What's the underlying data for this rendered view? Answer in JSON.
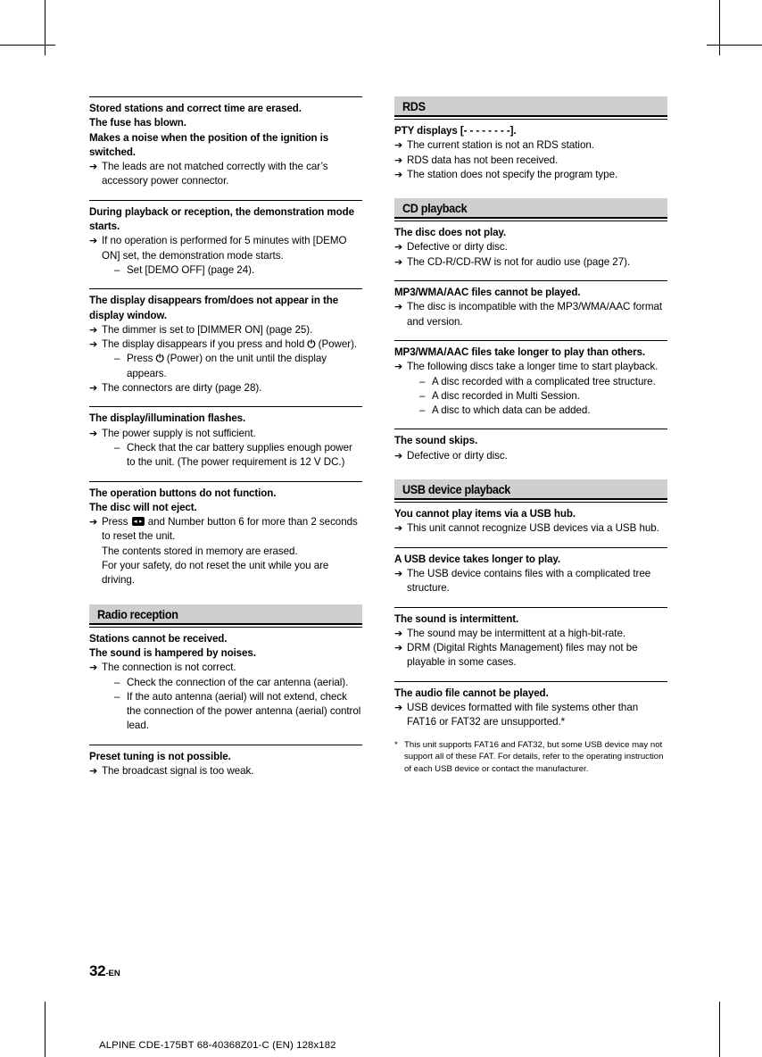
{
  "document": {
    "page_number": "32",
    "page_number_suffix": "-EN",
    "footer": "ALPINE CDE-175BT 68-40368Z01-C (EN) 128x182"
  },
  "left_column": {
    "blocks": [
      {
        "symptoms": [
          "Stored stations and correct time are erased.",
          "The fuse has blown.",
          "Makes a noise when the position of the ignition is switched."
        ],
        "causes": [
          {
            "text": "The leads are not matched correctly with the car’s accessory power connector.",
            "remedies": []
          }
        ]
      },
      {
        "symptoms": [
          "During playback or reception, the demonstration mode starts."
        ],
        "causes": [
          {
            "text": "If no operation is performed for 5 minutes with [DEMO ON] set, the demonstration mode starts.",
            "remedies": [
              "Set [DEMO OFF] (page 24)."
            ]
          }
        ]
      },
      {
        "symptoms": [
          "The display disappears from/does not appear in the display window."
        ],
        "causes": [
          {
            "text": "The dimmer is set to [DIMMER ON] (page 25).",
            "remedies": []
          },
          {
            "text_pre": "The display disappears if you press and hold ",
            "text_post": " (Power).",
            "glyph": "power-icon",
            "remedies_rich": [
              {
                "text_pre": "Press ",
                "text_post": " (Power) on the unit until the display appears.",
                "glyph": "power-icon"
              }
            ]
          },
          {
            "text": "The connectors are dirty (page 28).",
            "remedies": []
          }
        ]
      },
      {
        "symptoms": [
          "The display/illumination flashes."
        ],
        "causes": [
          {
            "text": "The power supply is not sufficient.",
            "remedies": [
              "Check that the car battery supplies enough power to the unit. (The power requirement is 12 V DC.)"
            ]
          }
        ]
      },
      {
        "symptoms": [
          "The operation buttons do not function.",
          "The disc will not eject."
        ],
        "causes": [
          {
            "text_pre": "Press ",
            "text_post": " and Number button 6 for more than 2 seconds to reset the unit.",
            "glyph": "source-button-icon",
            "extra_lines": [
              "The contents stored in memory are erased.",
              "For your safety, do not reset the unit while you are driving."
            ]
          }
        ]
      }
    ],
    "section": {
      "title": "Radio reception",
      "blocks": [
        {
          "symptoms": [
            "Stations cannot be received.",
            "The sound is hampered by noises."
          ],
          "causes": [
            {
              "text": "The connection is not correct.",
              "remedies": [
                "Check the connection of the car antenna (aerial).",
                "If the auto antenna (aerial) will not extend, check the connection of the power antenna (aerial) control lead."
              ]
            }
          ]
        },
        {
          "symptoms": [
            "Preset tuning is not possible."
          ],
          "causes": [
            {
              "text": "The broadcast signal is too weak.",
              "remedies": []
            }
          ]
        }
      ]
    }
  },
  "right_column": {
    "sections": [
      {
        "title": "RDS",
        "blocks": [
          {
            "symptoms": [
              "PTY displays [- - - - - - - -]."
            ],
            "causes": [
              {
                "text": "The current station is not an RDS station.",
                "remedies": []
              },
              {
                "text": "RDS data has not been received.",
                "remedies": []
              },
              {
                "text": "The station does not specify the program type.",
                "remedies": []
              }
            ]
          }
        ]
      },
      {
        "title": "CD playback",
        "blocks": [
          {
            "symptoms": [
              "The disc does not play."
            ],
            "causes": [
              {
                "text": "Defective or dirty disc.",
                "remedies": []
              },
              {
                "text": "The CD-R/CD-RW is not for audio use (page 27).",
                "remedies": []
              }
            ]
          },
          {
            "symptoms": [
              "MP3/WMA/AAC files cannot be played."
            ],
            "causes": [
              {
                "text": "The disc is incompatible with the MP3/WMA/AAC format and version.",
                "remedies": []
              }
            ]
          },
          {
            "symptoms": [
              "MP3/WMA/AAC files take longer to play than others."
            ],
            "causes": [
              {
                "text": "The following discs take a longer time to start playback.",
                "remedies": [
                  "A disc recorded with a complicated tree structure.",
                  "A disc recorded in Multi Session.",
                  "A disc to which data can be added."
                ]
              }
            ]
          },
          {
            "symptoms": [
              "The sound skips."
            ],
            "causes": [
              {
                "text": "Defective or dirty disc.",
                "remedies": []
              }
            ]
          }
        ]
      },
      {
        "title": "USB device playback",
        "blocks": [
          {
            "symptoms": [
              "You cannot play items via a USB hub."
            ],
            "causes": [
              {
                "text": "This unit cannot recognize USB devices via a USB hub.",
                "remedies": []
              }
            ]
          },
          {
            "symptoms": [
              "A USB device takes longer to play."
            ],
            "causes": [
              {
                "text": "The USB device contains files with a complicated tree structure.",
                "remedies": []
              }
            ]
          },
          {
            "symptoms": [
              "The sound is intermittent."
            ],
            "causes": [
              {
                "text": "The sound may be intermittent at a high-bit-rate.",
                "remedies": []
              },
              {
                "text": "DRM (Digital Rights Management) files may not be playable in some cases.",
                "remedies": []
              }
            ]
          },
          {
            "symptoms": [
              "The audio file cannot be played."
            ],
            "causes": [
              {
                "text": "USB devices formatted with file systems other than FAT16 or FAT32 are unsupported.*",
                "remedies": []
              }
            ]
          }
        ],
        "footnote": {
          "marker": "*",
          "text": "This unit supports FAT16 and FAT32, but some USB device may not support all of these FAT. For details, refer to the operating instruction of each USB device or contact the manufacturer."
        }
      }
    ]
  },
  "glyphs": {
    "arrow": "➔",
    "dash": "–",
    "power": "⏻"
  }
}
